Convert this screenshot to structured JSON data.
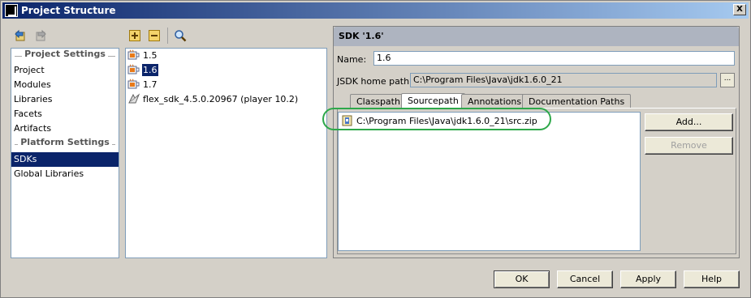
{
  "window": {
    "title": "Project Structure",
    "close_label": "X"
  },
  "sidebar": {
    "project_settings_header": "Project Settings",
    "items_project": [
      "Project",
      "Modules",
      "Libraries",
      "Facets",
      "Artifacts"
    ],
    "platform_settings_header": "Platform Settings",
    "items_platform": [
      "SDKs",
      "Global Libraries"
    ],
    "selected": "SDKs"
  },
  "sdk_list": {
    "items": [
      "1.5",
      "1.6",
      "1.7",
      "flex_sdk_4.5.0.20967 (player 10.2)"
    ],
    "selected": "1.6"
  },
  "detail": {
    "header": "SDK '1.6'",
    "name_label": "Name:",
    "name_value": "1.6",
    "home_label": "JSDK home path:",
    "home_value": "C:\\Program Files\\Java\\jdk1.6.0_21",
    "browse_label": "...",
    "tabs": [
      "Classpath",
      "Sourcepath",
      "Annotations",
      "Documentation Paths"
    ],
    "active_tab": "Sourcepath",
    "paths": [
      "C:\\Program Files\\Java\\jdk1.6.0_21\\src.zip"
    ],
    "add_label": "Add...",
    "remove_label": "Remove"
  },
  "footer": {
    "ok": "OK",
    "cancel": "Cancel",
    "apply": "Apply",
    "help": "Help"
  },
  "colors": {
    "selection": "#0a246a",
    "highlight_oval": "#2ea84a",
    "title_gradient_start": "#0a246a"
  }
}
